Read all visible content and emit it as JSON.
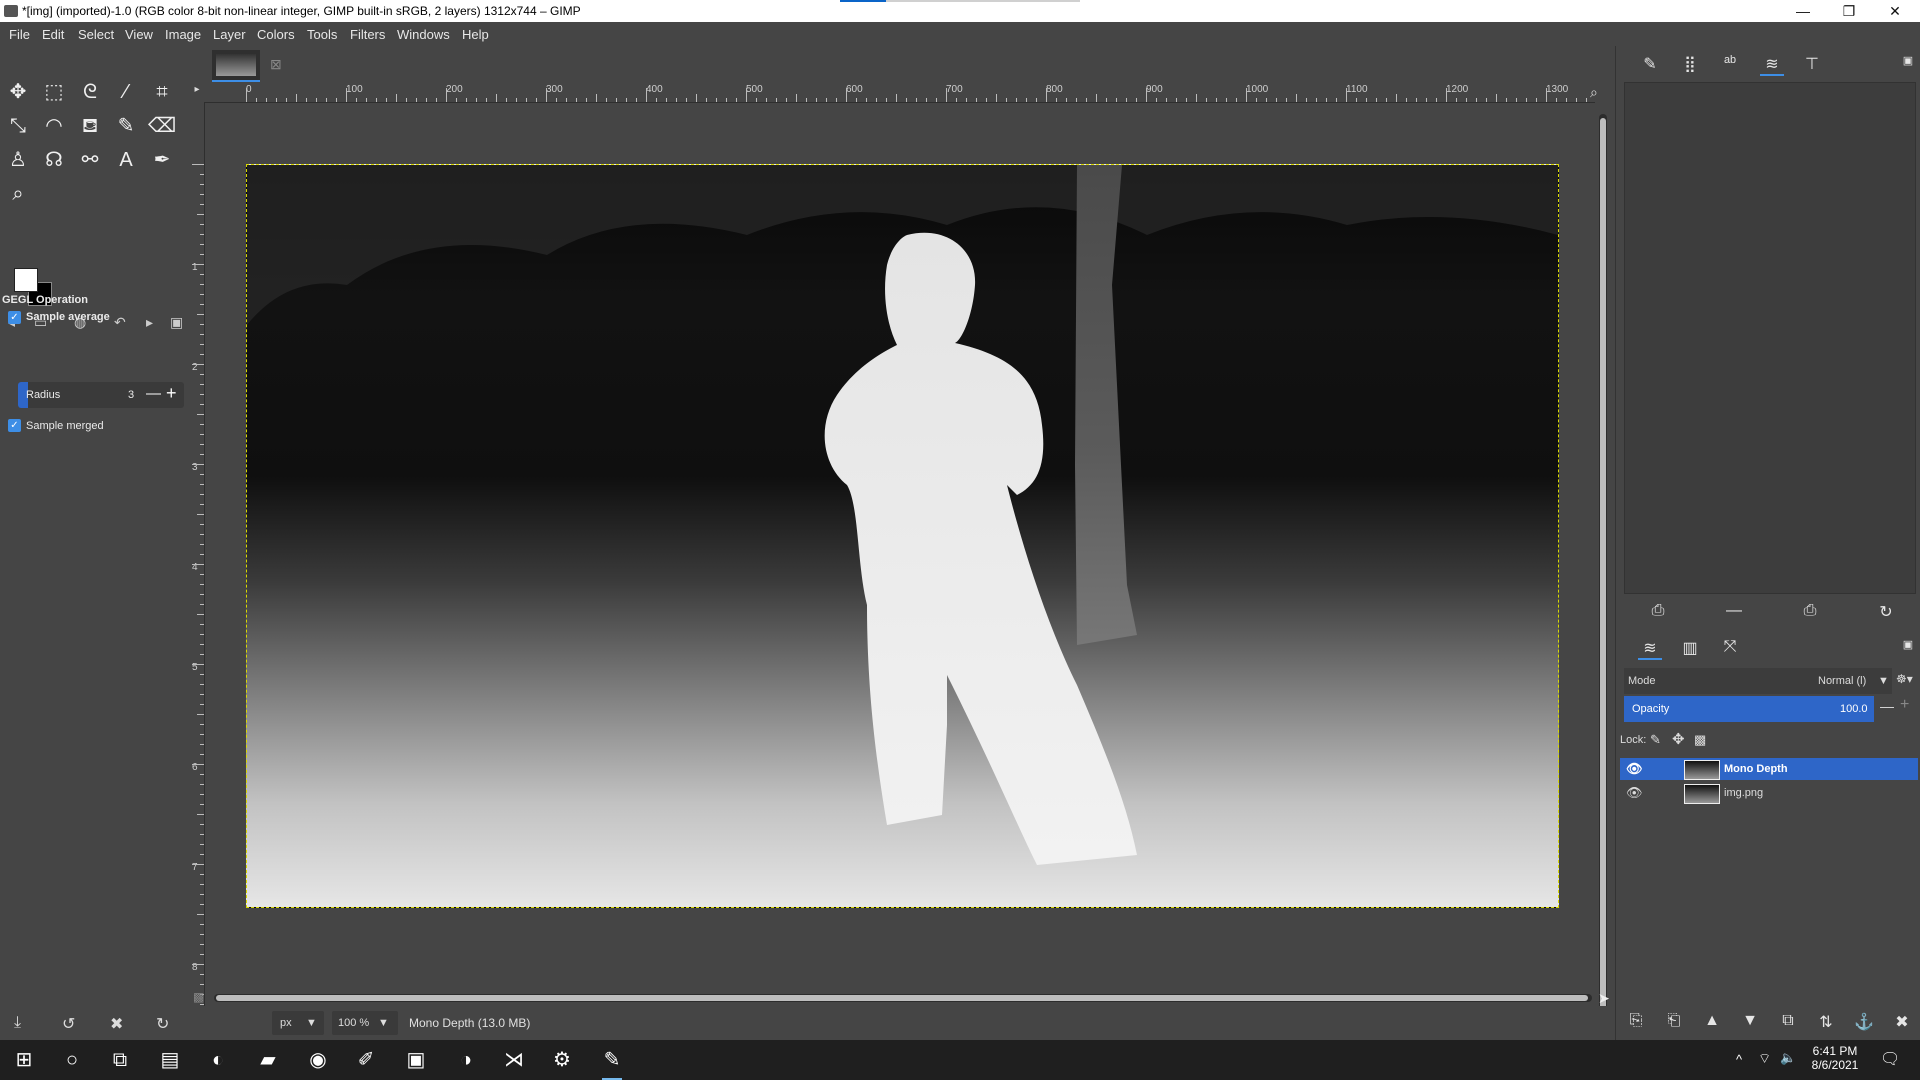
{
  "window": {
    "title": "*[img] (imported)-1.0 (RGB color 8-bit non-linear integer, GIMP built-in sRGB, 2 layers) 1312x744 – GIMP",
    "minimize": "—",
    "restore": "❐",
    "close": "✕"
  },
  "menu": [
    "File",
    "Edit",
    "Select",
    "View",
    "Image",
    "Layer",
    "Colors",
    "Tools",
    "Filters",
    "Windows",
    "Help"
  ],
  "toolbox": {
    "tools": [
      {
        "name": "move-tool-icon",
        "glyph": "✥"
      },
      {
        "name": "rect-select-icon",
        "glyph": "⬚"
      },
      {
        "name": "free-select-icon",
        "glyph": "ᘓ"
      },
      {
        "name": "fuzzy-select-icon",
        "glyph": "⁄"
      },
      {
        "name": "crop-icon",
        "glyph": "⌗"
      },
      {
        "name": "unified-transform-icon",
        "glyph": "⤡"
      },
      {
        "name": "warp-transform-icon",
        "glyph": "◠"
      },
      {
        "name": "bucket-fill-icon",
        "glyph": "⛾"
      },
      {
        "name": "paintbrush-icon",
        "glyph": "✎"
      },
      {
        "name": "eraser-icon",
        "glyph": "⌫"
      },
      {
        "name": "clone-icon",
        "glyph": "♙"
      },
      {
        "name": "smudge-icon",
        "glyph": "☊"
      },
      {
        "name": "paths-icon",
        "glyph": "⚯"
      },
      {
        "name": "text-tool-icon",
        "glyph": "A"
      },
      {
        "name": "color-picker-icon",
        "glyph": "✒"
      },
      {
        "name": "zoom-tool-icon",
        "glyph": "⌕"
      }
    ],
    "options_tabs": [
      "◂",
      "▭",
      "◍",
      "↶",
      "▸",
      "▣"
    ],
    "options": {
      "header": "GEGL Operation",
      "sample_average": "Sample average",
      "radius_label": "Radius",
      "radius_value": "3",
      "minus": "—",
      "plus": "+",
      "sample_merged": "Sample merged"
    },
    "bottom_icons": [
      "⤓",
      "↺",
      "✖",
      "↻"
    ]
  },
  "canvas": {
    "ruler_h": [
      "0",
      "100",
      "200",
      "300",
      "400",
      "500",
      "600",
      "700",
      "800",
      "900",
      "1000",
      "1100",
      "1200",
      "1300"
    ],
    "ruler_v": [
      "1",
      "2",
      "3",
      "4",
      "5",
      "6",
      "7",
      "8"
    ],
    "unit": "px",
    "zoom": "100 %",
    "status": "Mono Depth (13.0 MB)"
  },
  "dock": {
    "top_tabs": [
      "✎",
      "⣿",
      "ᵃᵇ",
      "≋",
      "⊤"
    ],
    "top_buttons": [
      "⎙",
      "—",
      "⎙",
      "↻"
    ],
    "layer_tabs": [
      "≋",
      "▥",
      "⤧"
    ],
    "mode_label": "Mode",
    "mode_value": "Normal (l)",
    "opacity_label": "Opacity",
    "opacity_value": "100.0",
    "lock_label": "Lock:",
    "layers": [
      {
        "name": "Mono Depth",
        "selected": true
      },
      {
        "name": "img.png",
        "selected": false
      }
    ],
    "bottom_icons": [
      "⎘",
      "⎗",
      "▲",
      "▼",
      "⧉",
      "⇅",
      "⚓",
      "✖"
    ]
  },
  "taskbar": {
    "apps": [
      {
        "name": "start-icon",
        "glyph": "⊞"
      },
      {
        "name": "search-icon",
        "glyph": "○"
      },
      {
        "name": "task-view-icon",
        "glyph": "⧉"
      },
      {
        "name": "file-manager-icon",
        "glyph": "▤"
      },
      {
        "name": "edge-icon",
        "glyph": "◐"
      },
      {
        "name": "explorer-icon",
        "glyph": "▰"
      },
      {
        "name": "spotify-icon",
        "glyph": "◉"
      },
      {
        "name": "gimp-alt-icon",
        "glyph": "✐"
      },
      {
        "name": "pycharm-icon",
        "glyph": "▣"
      },
      {
        "name": "edge-dev-icon",
        "glyph": "◑"
      },
      {
        "name": "vscode-icon",
        "glyph": "⋊"
      },
      {
        "name": "settings-icon",
        "glyph": "⚙"
      },
      {
        "name": "gimp-icon",
        "glyph": "✎"
      }
    ],
    "tray": [
      "^",
      "⌔",
      "🔈"
    ],
    "time": "6:41 PM",
    "date": "8/6/2021",
    "notification": "🗨"
  }
}
